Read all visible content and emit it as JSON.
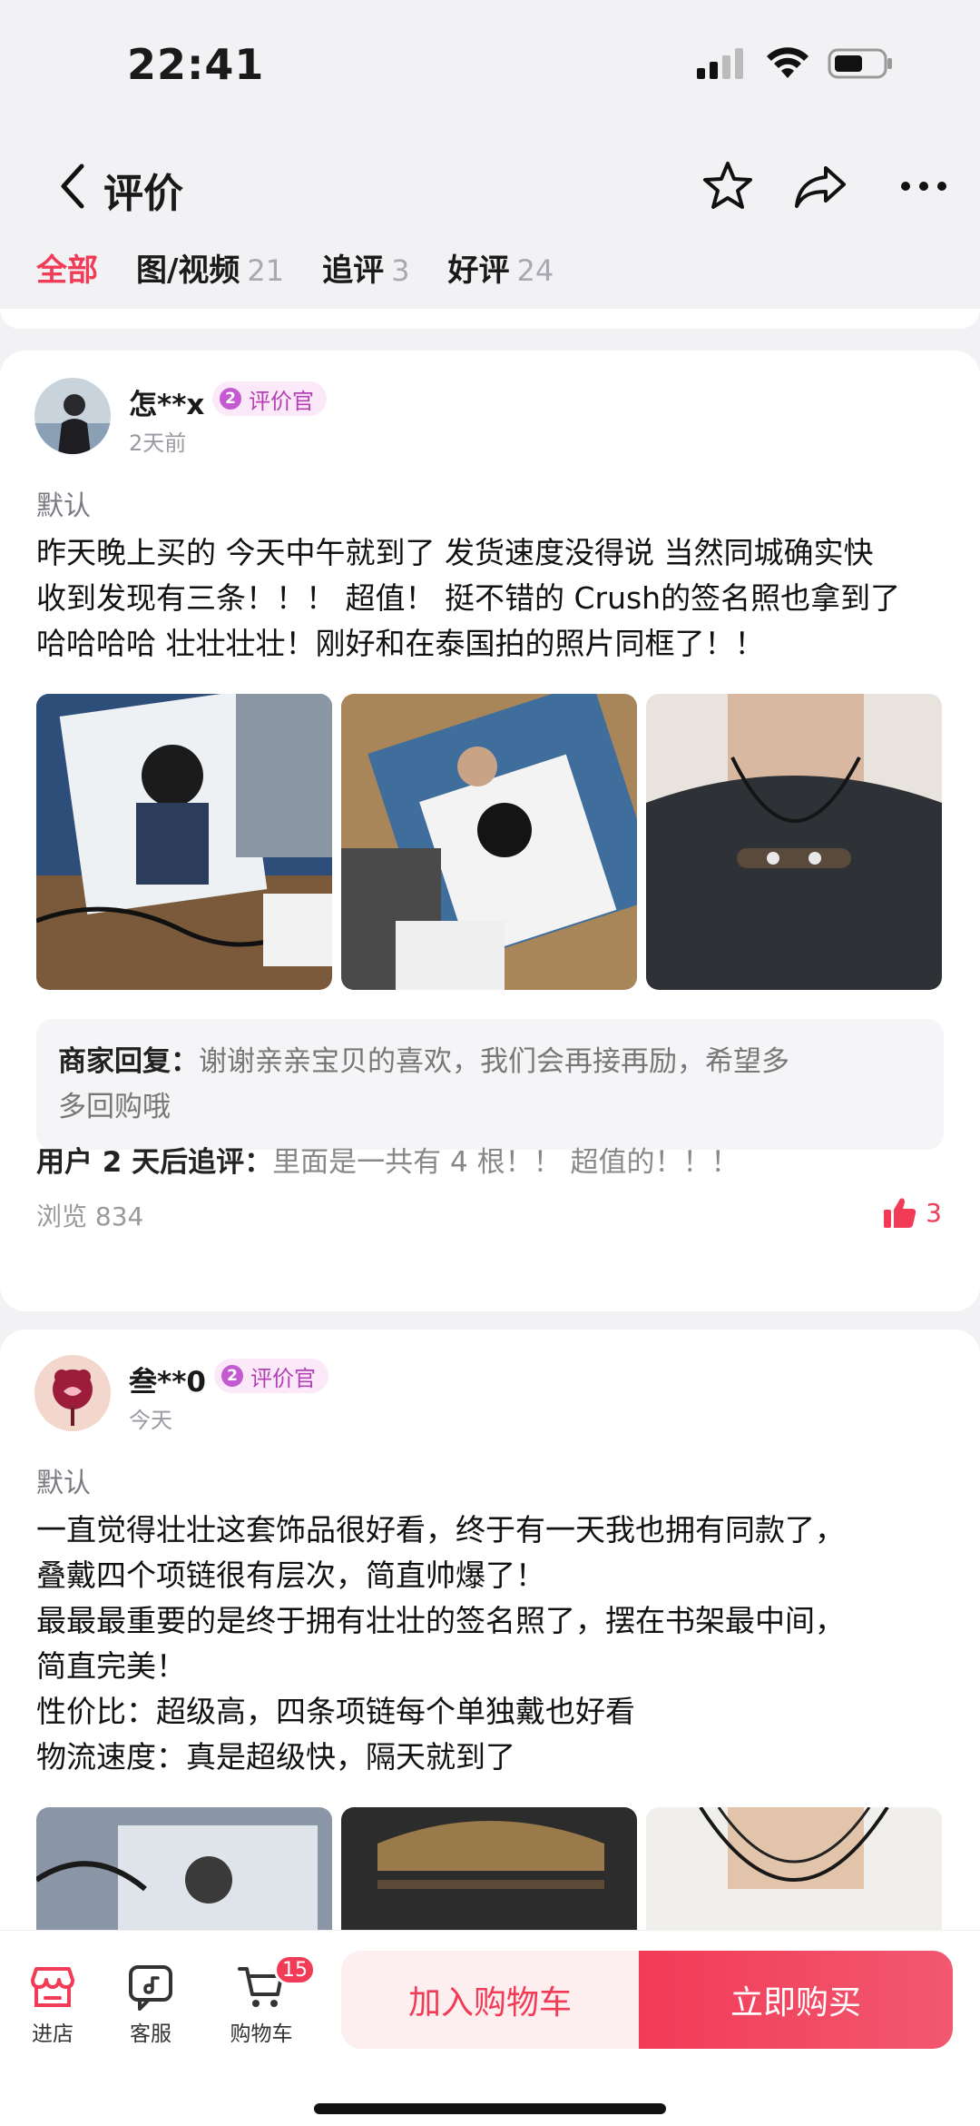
{
  "status": {
    "time": "22:41"
  },
  "nav": {
    "title": "评价"
  },
  "tabs": [
    {
      "label": "全部",
      "count": ""
    },
    {
      "label": "图/视频",
      "count": "21"
    },
    {
      "label": "追评",
      "count": "3"
    },
    {
      "label": "好评",
      "count": "24"
    }
  ],
  "reviews": [
    {
      "username": "怎**x",
      "badge_num": "2",
      "badge_label": "评价官",
      "time": "2天前",
      "spec": "默认",
      "lines": [
        "昨天晚上买的 今天中午就到了 发货速度没得说 当然同城确实快",
        "收到发现有三条！！！ 超值！ 挺不错的 Crush的签名照也拿到了",
        "哈哈哈哈 壮壮壮壮！刚好和在泰国拍的照片同框了！！"
      ],
      "reply_label": "商家回复：",
      "reply_lines": [
        "谢谢亲亲宝贝的喜欢，我们会再接再励，希望多",
        "多回购哦"
      ],
      "followup_label": "用户 2 天后追评：",
      "followup_text": "里面是一共有 4 根！！ 超值的！！！",
      "views": "浏览 834",
      "likes": "3"
    },
    {
      "username": "叁**0",
      "badge_num": "2",
      "badge_label": "评价官",
      "time": "今天",
      "spec": "默认",
      "lines": [
        "一直觉得壮壮这套饰品很好看，终于有一天我也拥有同款了，",
        "叠戴四个项链很有层次，简直帅爆了！",
        "最最最重要的是终于拥有壮壮的签名照了，摆在书架最中间，",
        "简直完美！",
        "性价比：超级高，四条项链每个单独戴也好看",
        "物流速度：真是超级快，隔天就到了"
      ]
    }
  ],
  "bottom": {
    "shop": "进店",
    "service": "客服",
    "cart": "购物车",
    "cart_count": "15",
    "add_to_cart": "加入购物车",
    "buy_now": "立即购买"
  },
  "colors": {
    "accent": "#f23b57",
    "badge": "#c35ad0"
  }
}
